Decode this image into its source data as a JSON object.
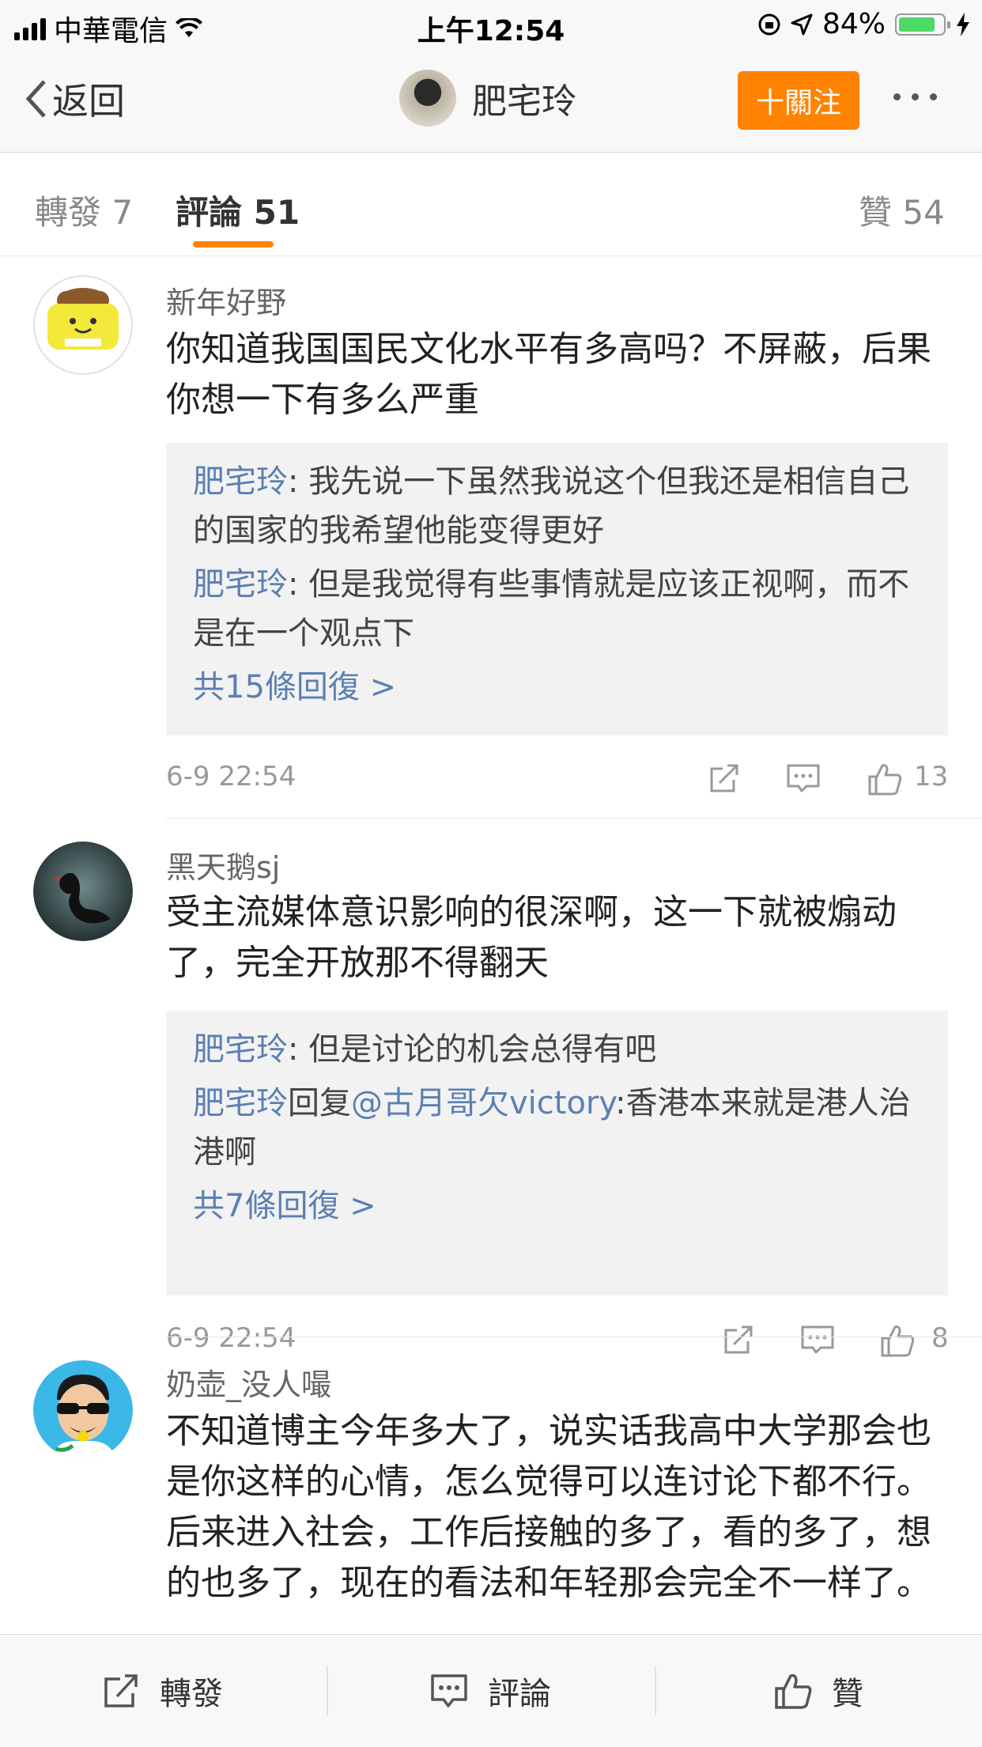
{
  "status_bar": {
    "carrier": "中華電信",
    "time": "上午12:54",
    "battery_percent": "84%",
    "battery_level": 0.84
  },
  "nav": {
    "back_label": "返回",
    "title": "肥宅玲",
    "follow_label": "十關注"
  },
  "tabs": {
    "repost": "轉發 7",
    "comments": "評論 51",
    "likes": "贊 54"
  },
  "comments": [
    {
      "username": "新年好野",
      "text": "你知道我国国民文化水平有多高吗？不屏蔽，后果你想一下有多么严重",
      "avatar_icon": "toast-avatar-icon",
      "replies": [
        {
          "user": "肥宅玲",
          "sep": ": ",
          "text": "我先说一下虽然我说这个但我还是相信自己的国家的我希望他能变得更好"
        },
        {
          "user": "肥宅玲",
          "sep": ": ",
          "text": "但是我觉得有些事情就是应该正视啊，而不是在一个观点下"
        }
      ],
      "more_replies": "共15條回復 >",
      "time": "6-9 22:54",
      "likes": "13"
    },
    {
      "username": "黑天鹅sj",
      "text": "受主流媒体意识影响的很深啊，这一下就被煽动了，完全开放那不得翻天",
      "avatar_icon": "black-swan-avatar-icon",
      "replies": [
        {
          "user": "肥宅玲",
          "sep": ": ",
          "text": "但是讨论的机会总得有吧"
        },
        {
          "user": "肥宅玲",
          "mid": "回复",
          "mention": "@古月哥欠victory",
          "text": ":香港本来就是港人治港啊"
        }
      ],
      "more_replies": "共7條回復 >",
      "time": "6-9 22:54",
      "likes": "8"
    },
    {
      "username": "奶壶_没人嘬",
      "text": "不知道博主今年多大了，说实话我高中大学那会也是你这样的心情，怎么觉得可以连讨论下都不行。后来进入社会，工作后接触的多了，看的多了，想的也多了，现在的看法和年轻那会完全不一样了。",
      "avatar_icon": "cartoon-sunglasses-avatar-icon"
    }
  ],
  "bottom_bar": {
    "repost": "轉發",
    "comment": "評論",
    "like": "贊"
  },
  "colors": {
    "accent": "#ff8200",
    "link": "#5b7fb2",
    "battery": "#4cd964"
  }
}
